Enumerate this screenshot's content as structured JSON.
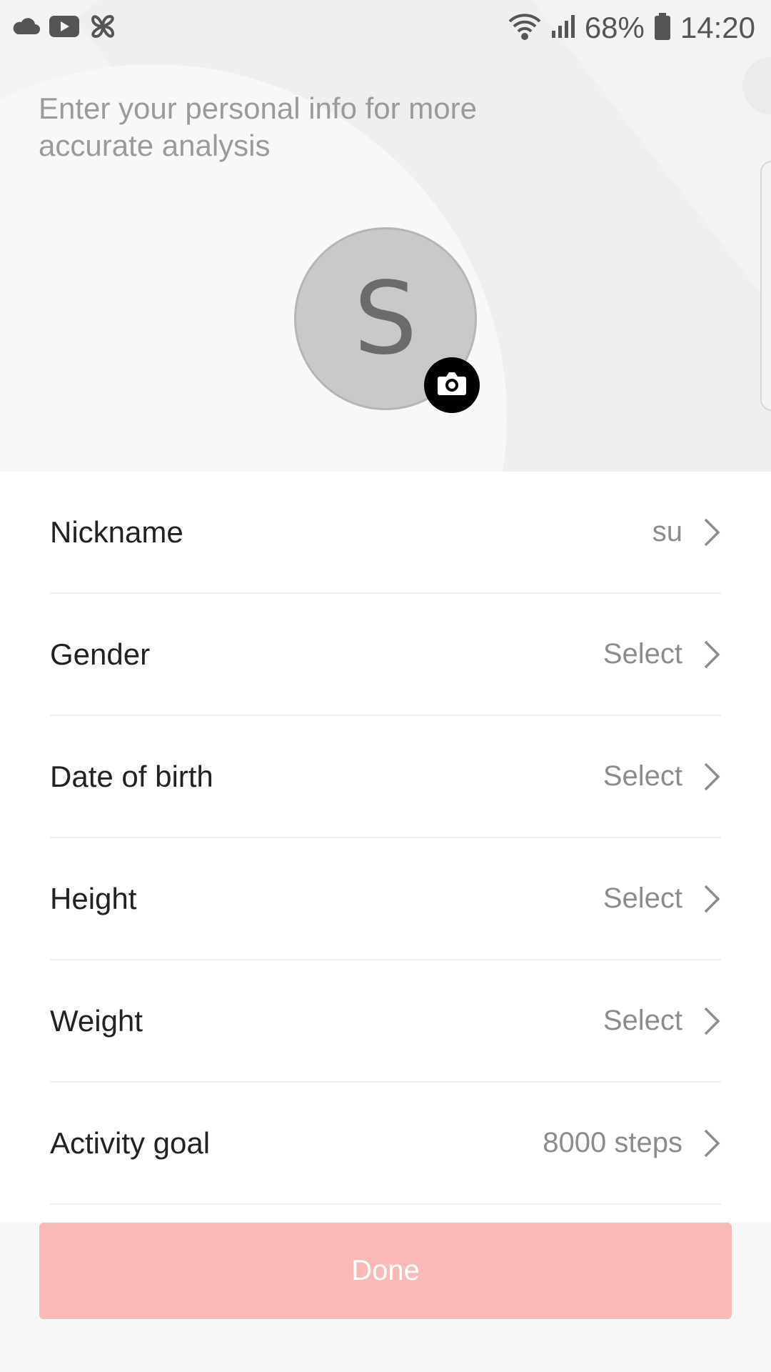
{
  "status_bar": {
    "battery": "68%",
    "time": "14:20",
    "icons": [
      "cloud-icon",
      "youtube-icon",
      "pinwheel-icon",
      "wifi-icon",
      "signal-icon",
      "battery-icon"
    ]
  },
  "intro_text": "Enter your personal info for more accurate analysis",
  "avatar": {
    "initial": "S"
  },
  "fields": [
    {
      "label": "Nickname",
      "value": "su"
    },
    {
      "label": "Gender",
      "value": "Select"
    },
    {
      "label": "Date of birth",
      "value": "Select"
    },
    {
      "label": "Height",
      "value": "Select"
    },
    {
      "label": "Weight",
      "value": "Select"
    },
    {
      "label": "Activity goal",
      "value": "8000 steps"
    }
  ],
  "done_label": "Done",
  "colors": {
    "done_button": "#fbb8b8",
    "avatar_bg": "#c9c9c9"
  }
}
